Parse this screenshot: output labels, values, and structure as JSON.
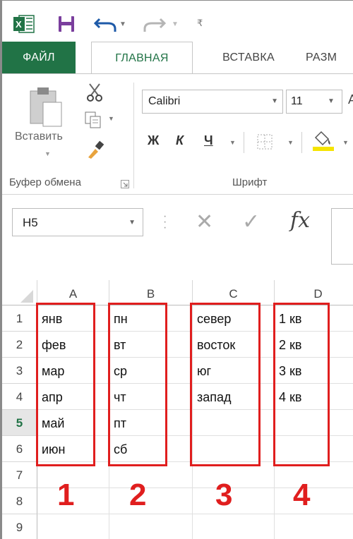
{
  "quick_access": {
    "excel_icon": "excel-app-icon",
    "save_icon": "save-icon",
    "undo_icon": "undo-icon",
    "redo_icon": "redo-icon",
    "customize_icon": "customize-toolbar-icon"
  },
  "tabs": [
    {
      "label": "ФАЙЛ"
    },
    {
      "label": "ГЛАВНАЯ"
    },
    {
      "label": "ВСТАВКА"
    },
    {
      "label": "РАЗМ"
    }
  ],
  "ribbon": {
    "clipboard": {
      "paste_label": "Вставить",
      "group_label": "Буфер обмена"
    },
    "font": {
      "font_name": "Calibri",
      "font_size": "11",
      "bold": "Ж",
      "italic": "К",
      "underline": "Ч",
      "grow_font": "A",
      "group_label": "Шрифт"
    }
  },
  "formula_bar": {
    "name_box": "H5",
    "cancel": "✕",
    "enter": "✓",
    "fx": "fx"
  },
  "grid": {
    "columns": [
      "A",
      "B",
      "C",
      "D"
    ],
    "rows": [
      "1",
      "2",
      "3",
      "4",
      "5",
      "6",
      "7",
      "8",
      "9"
    ],
    "active_row": "5",
    "cells": {
      "A": [
        "янв",
        "фев",
        "мар",
        "апр",
        "май",
        "июн"
      ],
      "B": [
        "пн",
        "вт",
        "ср",
        "чт",
        "пт",
        "сб"
      ],
      "C": [
        "север",
        "восток",
        "юг",
        "запад"
      ],
      "D": [
        "1 кв",
        "2 кв",
        "3 кв",
        "4 кв"
      ]
    },
    "annotations": [
      "1",
      "2",
      "3",
      "4"
    ]
  },
  "colors": {
    "excel_green": "#217346",
    "annotation_red": "#e01e1e"
  }
}
